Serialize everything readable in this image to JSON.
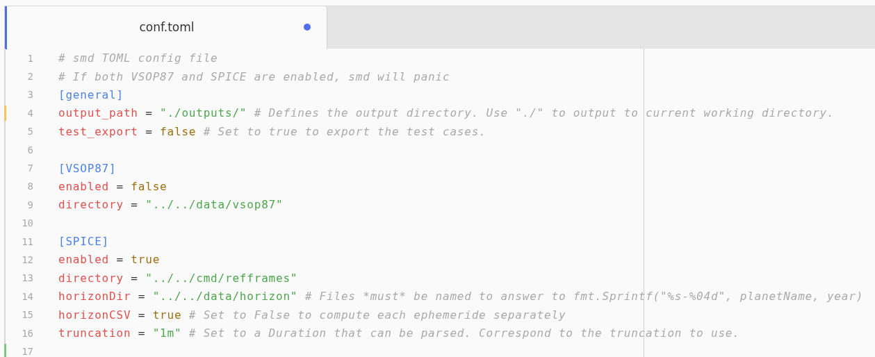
{
  "tab": {
    "title": "conf.toml",
    "selected": true,
    "modified": true
  },
  "lines": [
    {
      "number": "1",
      "tokens": [
        {
          "kind": "comment",
          "text": "# smd TOML config file"
        }
      ]
    },
    {
      "number": "2",
      "tokens": [
        {
          "kind": "comment",
          "text": "# If both VSOP87 and SPICE are enabled, smd will panic"
        }
      ]
    },
    {
      "number": "3",
      "tokens": [
        {
          "kind": "section",
          "text": "[general]"
        }
      ]
    },
    {
      "number": "4",
      "modified": true,
      "tokens": [
        {
          "kind": "key",
          "text": "output_path"
        },
        {
          "kind": "op",
          "text": "="
        },
        {
          "kind": "string",
          "text": "\"./outputs/\""
        },
        {
          "kind": "comment",
          "text": "# Defines the output directory. Use \"./\" to output to current working directory."
        }
      ]
    },
    {
      "number": "5",
      "tokens": [
        {
          "kind": "key",
          "text": "test_export"
        },
        {
          "kind": "op",
          "text": "="
        },
        {
          "kind": "bool",
          "text": "false"
        },
        {
          "kind": "comment",
          "text": "# Set to true to export the test cases."
        }
      ]
    },
    {
      "number": "6"
    },
    {
      "number": "7",
      "tokens": [
        {
          "kind": "section",
          "text": "[VSOP87]"
        }
      ]
    },
    {
      "number": "8",
      "tokens": [
        {
          "kind": "key",
          "text": "enabled"
        },
        {
          "kind": "op",
          "text": "="
        },
        {
          "kind": "bool",
          "text": "false"
        }
      ]
    },
    {
      "number": "9",
      "tokens": [
        {
          "kind": "key",
          "text": "directory"
        },
        {
          "kind": "op",
          "text": "="
        },
        {
          "kind": "string",
          "text": "\"../../data/vsop87\""
        }
      ]
    },
    {
      "number": "10"
    },
    {
      "number": "11",
      "tokens": [
        {
          "kind": "section",
          "text": "[SPICE]"
        }
      ]
    },
    {
      "number": "12",
      "tokens": [
        {
          "kind": "key",
          "text": "enabled"
        },
        {
          "kind": "op",
          "text": "="
        },
        {
          "kind": "bool",
          "text": "true"
        }
      ]
    },
    {
      "number": "13",
      "tokens": [
        {
          "kind": "key",
          "text": "directory"
        },
        {
          "kind": "op",
          "text": "="
        },
        {
          "kind": "string",
          "text": "\"../../cmd/refframes\""
        }
      ]
    },
    {
      "number": "14",
      "tokens": [
        {
          "kind": "key",
          "text": "horizonDir"
        },
        {
          "kind": "op",
          "text": "="
        },
        {
          "kind": "string",
          "text": "\"../../data/horizon\""
        },
        {
          "kind": "comment",
          "text": "# Files *must* be named to answer to fmt.Sprintf(\"%s-%04d\", planetName, year)"
        }
      ]
    },
    {
      "number": "15",
      "tokens": [
        {
          "kind": "key",
          "text": "horizonCSV"
        },
        {
          "kind": "op",
          "text": "="
        },
        {
          "kind": "bool",
          "text": "true"
        },
        {
          "kind": "comment",
          "text": "# Set to False to compute each ephemeride separately"
        }
      ]
    },
    {
      "number": "16",
      "tokens": [
        {
          "kind": "key",
          "text": "truncation"
        },
        {
          "kind": "op",
          "text": "="
        },
        {
          "kind": "string",
          "text": "\"1m\""
        },
        {
          "kind": "comment",
          "text": "# Set to a Duration that can be parsed. Correspond to the truncation to use."
        }
      ]
    },
    {
      "number": "17",
      "added": true
    }
  ]
}
